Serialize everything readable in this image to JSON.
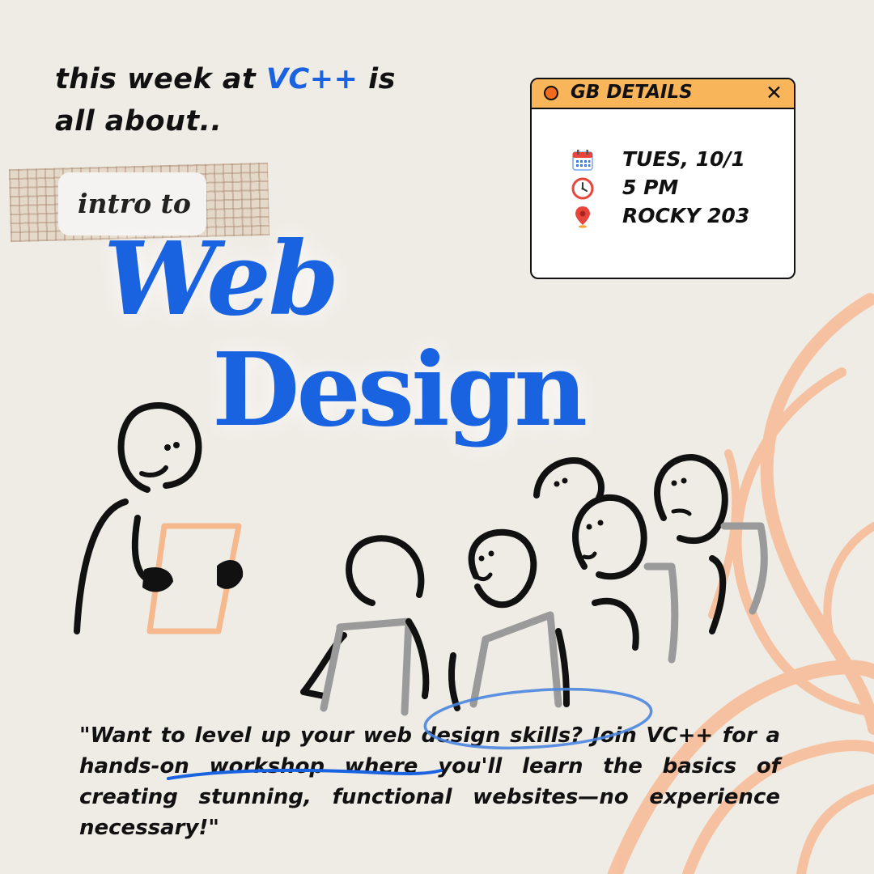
{
  "headline": {
    "line1_before": "this week at ",
    "brand": "VC++",
    "line1_after": " is",
    "line2": "all about.."
  },
  "intro_label": "intro to",
  "title": {
    "line1": "Web",
    "line2": "Design"
  },
  "details_window": {
    "title": "GB DETAILS",
    "close_glyph": "✕",
    "items": [
      {
        "icon": "calendar-icon",
        "text": "TUES, 10/1"
      },
      {
        "icon": "clock-icon",
        "text": "5 PM"
      },
      {
        "icon": "location-pin-icon",
        "text": "ROCKY 203"
      }
    ]
  },
  "quote": "\"Want to level up your web design skills? Join VC++ for a hands-on workshop where you'll learn the basics of creating stunning, functional websites—no experience necessary!\"",
  "colors": {
    "background": "#efebe5",
    "brand_blue": "#1a63e0",
    "window_header": "#f9b55a",
    "dot_orange": "#f06a1f",
    "swirl_peach": "#f8b48a"
  }
}
